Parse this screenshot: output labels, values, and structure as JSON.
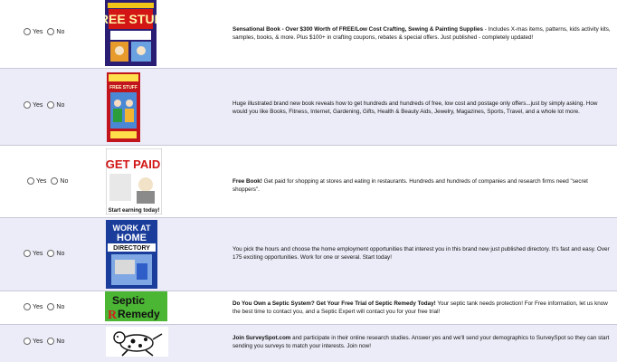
{
  "radio_labels": {
    "yes": "Yes",
    "no": "No"
  },
  "offers": [
    {
      "id": "free-stuff-book",
      "title": "Sensational Book - Over $300 Worth of FREE/Low Cost Crafting, Sewing & Painting Supplies",
      "body": " - Includes X-mas items, patterns, kids activity kits, samples, books, & more. Plus $100+ in crafting coupons, rebates & special offers. Just published - completely updated!",
      "cover_text": "FREE STUFF"
    },
    {
      "id": "free-offers-book",
      "title": "",
      "body": "Huge illustrated brand new book reveals how to get hundreds and hundreds of free, low cost and postage only offers...just by simply asking. How would you like Books, Fitness, Internet, Gardening, Gifts, Health & Beauty Aids, Jewelry, Magazines, Sports, Travel, and a whole lot more.",
      "cover_text": "FREE STUFF"
    },
    {
      "id": "get-paid",
      "title": "Free Book!",
      "body": " Get paid for shopping at stores and eating in restaurants. Hundreds and hundreds of companies and research firms need \"secret shoppers\".",
      "cover_text": "GET PAID",
      "cover_subtext": "Start earning today!"
    },
    {
      "id": "work-at-home",
      "title": "",
      "body": "You pick the hours and choose the home employment opportunities that interest you in this brand new just published directory. It's fast and easy. Over 175 exciting opportunities. Work for one or several. Start today!",
      "cover_line1": "WORK AT",
      "cover_line2": "HOME",
      "cover_line3": "DIRECTORY"
    },
    {
      "id": "septic-remedy",
      "title": "Do You Own a Septic System? Get Your Free Trial of Septic Remedy Today!",
      "body": " Your septic tank needs protection! For Free information, let us know the best time to contact you, and a Septic Expert will contact you for your free trial!",
      "logo_line1": "Septic",
      "logo_line2": "Remedy"
    },
    {
      "id": "surveyspot",
      "title": "Join SurveySpot.com",
      "body": " and participate in their online research studies. Answer yes and we'll send your demographics to SurveySpot so they can start sending you surveys to match your interests. Join now!"
    }
  ]
}
